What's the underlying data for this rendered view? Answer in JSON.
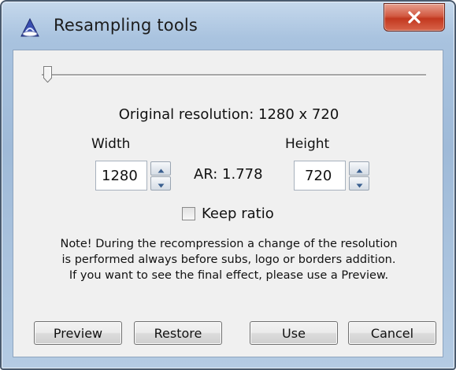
{
  "window": {
    "title": "Resampling tools",
    "app_icon": "app-logo-icon",
    "close_icon": "close-icon"
  },
  "slider": {
    "value_fraction": 0.0
  },
  "original_resolution": "Original resolution: 1280 x 720",
  "width": {
    "label": "Width",
    "value": "1280"
  },
  "height": {
    "label": "Height",
    "value": "720"
  },
  "aspect_ratio": "AR: 1.778",
  "keep_ratio": {
    "label": "Keep ratio",
    "checked": false
  },
  "note": {
    "line1": "Note! During the recompression a change of the resolution",
    "line2": "is performed always before subs, logo or borders addition.",
    "line3": "If you want to see the final effect, please use a Preview."
  },
  "buttons": {
    "preview": "Preview",
    "restore": "Restore",
    "use": "Use",
    "cancel": "Cancel"
  },
  "colors": {
    "frame": "#a9c3df",
    "client": "#f0f0f0",
    "close": "#c2381f"
  }
}
